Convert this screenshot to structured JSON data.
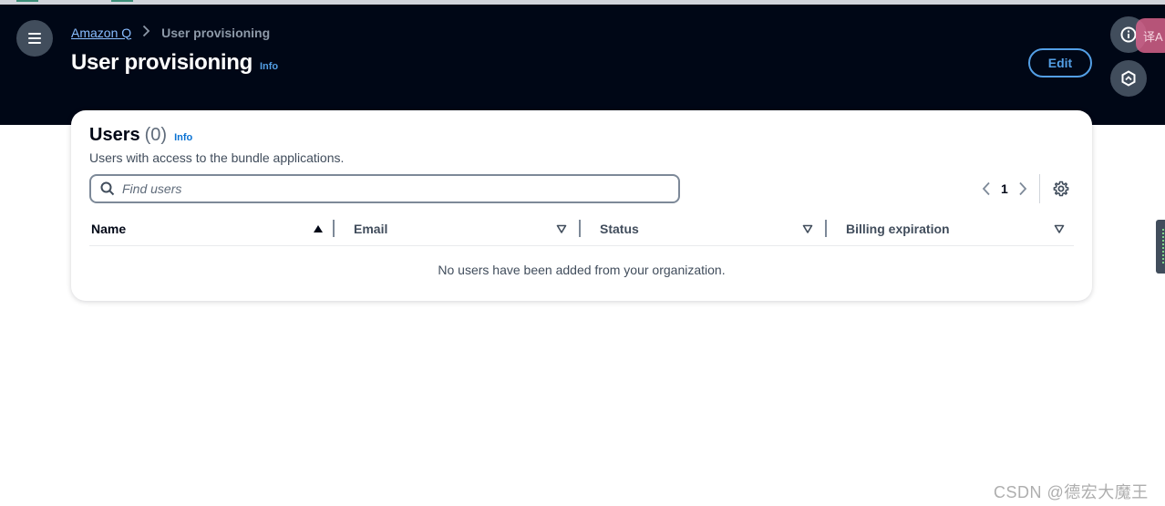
{
  "breadcrumb": {
    "parent": "Amazon Q",
    "current": "User provisioning"
  },
  "header": {
    "title": "User provisioning",
    "info": "Info",
    "edit_label": "Edit",
    "translate_label": "译A"
  },
  "users_panel": {
    "title": "Users",
    "count": "(0)",
    "info": "Info",
    "description": "Users with access to the bundle applications.",
    "search_placeholder": "Find users",
    "search_value": "",
    "current_page": "1",
    "columns": [
      "Name",
      "Email",
      "Status",
      "Billing expiration"
    ],
    "sorted_column": "Name",
    "empty_message": "No users have been added from your organization."
  },
  "watermark": "CSDN @德宏大魔王",
  "colors": {
    "header_bg": "#000716",
    "link_dark": "#539fe5",
    "link_light": "#0972d3",
    "edit_border": "#539fe5"
  },
  "icons": {
    "menu": "menu-icon",
    "info_circle": "info-circle-icon",
    "hex": "hexagon-icon",
    "search": "search-icon",
    "prev": "chevron-left-icon",
    "next": "chevron-right-icon",
    "settings": "gear-icon",
    "sort_asc": "caret-up-filled-icon",
    "sort_none": "caret-down-outline-icon"
  }
}
